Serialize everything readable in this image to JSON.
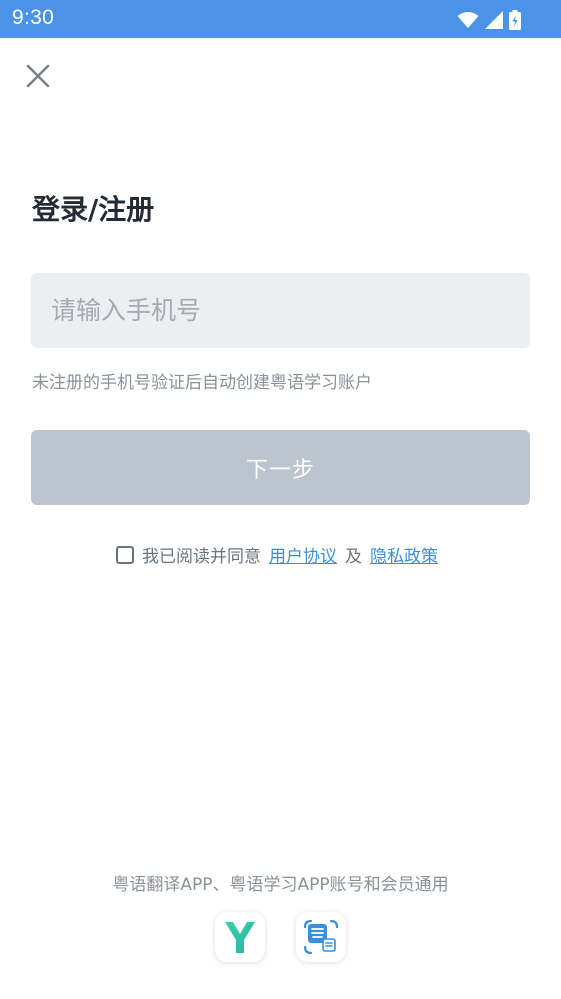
{
  "status_bar": {
    "time": "9:30",
    "icons": [
      "wifi-icon",
      "signal-icon",
      "battery-charging-icon"
    ],
    "background_color": "#4a93e8"
  },
  "close_icon": "close-icon",
  "title": "登录/注册",
  "phone_input": {
    "placeholder": "请输入手机号",
    "value": ""
  },
  "hint": "未注册的手机号验证后自动创建粤语学习账户",
  "next_button": {
    "label": "下一步",
    "enabled": false
  },
  "agreement": {
    "checked": false,
    "prefix": "我已阅读并同意",
    "user_agreement": "用户协议",
    "conjunction": "及",
    "privacy_policy": "隐私政策"
  },
  "footer": {
    "text": "粤语翻译APP、粤语学习APP账号和会员通用",
    "apps": [
      "app-logo-y-icon",
      "app-logo-cantonese-translate-icon"
    ]
  },
  "colors": {
    "accent": "#3a8fdc",
    "button_disabled": "#bcc5ce",
    "input_background": "#eceef1"
  }
}
